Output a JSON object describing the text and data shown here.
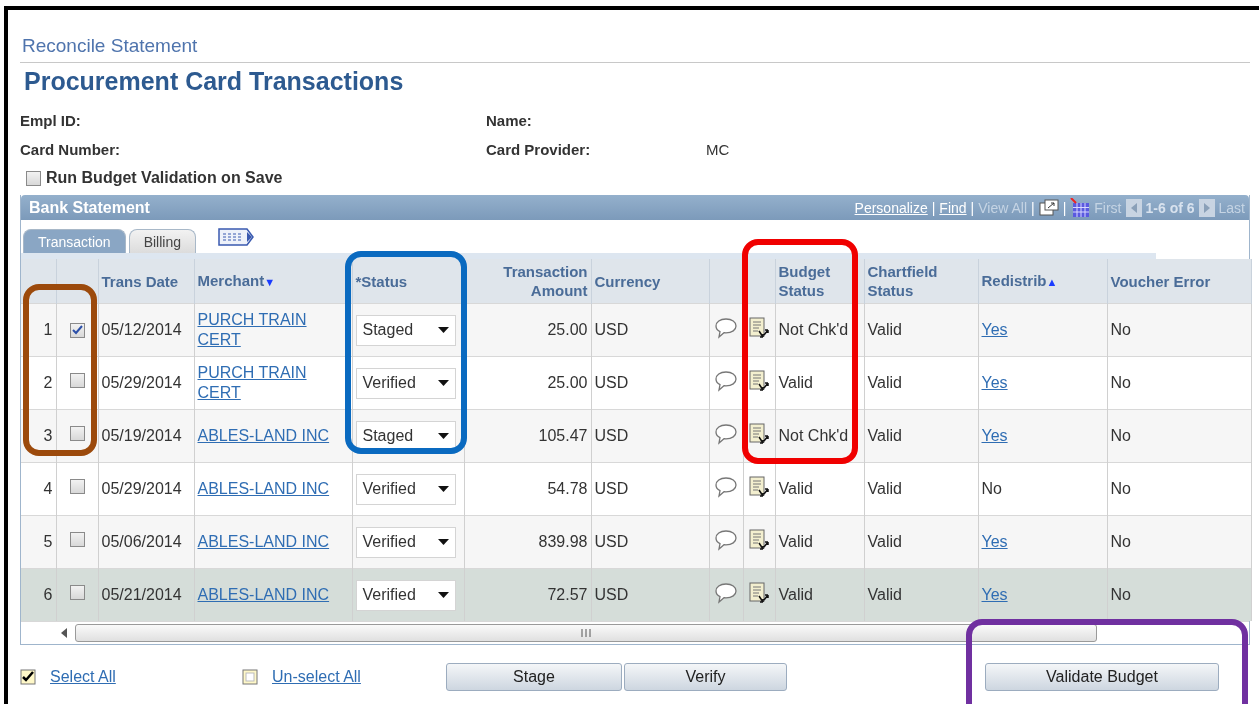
{
  "breadcrumb": "Reconcile Statement",
  "title": "Procurement Card Transactions",
  "fields": [
    {
      "label": "Empl ID:"
    },
    {
      "label": "Name:"
    },
    {
      "label": "Card Number:"
    },
    {
      "label": "Card Provider:",
      "value": "MC"
    }
  ],
  "run_budget_validation": {
    "label": "Run Budget Validation on Save",
    "checked": false
  },
  "grid": {
    "title": "Bank Statement",
    "nav": [
      {
        "kind": "link",
        "text": "Personalize"
      },
      {
        "kind": "separator",
        "text": "|"
      },
      {
        "kind": "link",
        "text": "Find"
      },
      {
        "kind": "separator",
        "text": "|"
      },
      {
        "kind": "disabled",
        "text": "View All"
      },
      {
        "kind": "separator",
        "text": "|"
      },
      {
        "kind": "zoom"
      },
      {
        "kind": "separator",
        "text": "|"
      },
      {
        "kind": "download"
      },
      {
        "kind": "disabled",
        "text": "First"
      },
      {
        "kind": "prev"
      },
      {
        "kind": "count",
        "text": "1-6 of 6"
      },
      {
        "kind": "next"
      },
      {
        "kind": "disabled",
        "text": "Last"
      }
    ],
    "tabs": [
      {
        "label": "Transaction",
        "selected": true
      },
      {
        "label": "Billing",
        "selected": false
      }
    ],
    "columns": [
      {},
      {},
      {
        "label": "Trans Date"
      },
      {
        "label": "Merchant",
        "sort_arrow": "▼"
      },
      {
        "label": "*Status"
      },
      {
        "label": "Transaction Amount"
      },
      {
        "label": "Currency"
      },
      {},
      {},
      {
        "label": "Budget Status"
      },
      {
        "label": "Chartfield Status"
      },
      {
        "label": "Redistrib",
        "sort_arrow": "▲"
      },
      {
        "label": "Voucher Error"
      }
    ],
    "rows": [
      {
        "num": "1",
        "checked": true,
        "date": "05/12/2014",
        "merchant": "PURCH TRAIN CERT",
        "status": "Staged",
        "amount": "25.00",
        "currency": "USD",
        "budget_status": "Not Chk'd",
        "chartfield_status": "Valid",
        "redistrib": {
          "text": "Yes",
          "link": true
        },
        "voucher_error": "No",
        "highlighted": false
      },
      {
        "num": "2",
        "checked": false,
        "date": "05/29/2014",
        "merchant": "PURCH TRAIN CERT",
        "status": "Verified",
        "amount": "25.00",
        "currency": "USD",
        "budget_status": "Valid",
        "chartfield_status": "Valid",
        "redistrib": {
          "text": "Yes",
          "link": true
        },
        "voucher_error": "No",
        "highlighted": false
      },
      {
        "num": "3",
        "checked": false,
        "date": "05/19/2014",
        "merchant": "ABLES-LAND INC",
        "status": "Staged",
        "amount": "105.47",
        "currency": "USD",
        "budget_status": "Not Chk'd",
        "chartfield_status": "Valid",
        "redistrib": {
          "text": "Yes",
          "link": true
        },
        "voucher_error": "No",
        "highlighted": false
      },
      {
        "num": "4",
        "checked": false,
        "date": "05/29/2014",
        "merchant": "ABLES-LAND INC",
        "status": "Verified",
        "amount": "54.78",
        "currency": "USD",
        "budget_status": "Valid",
        "chartfield_status": "Valid",
        "redistrib": {
          "text": "No",
          "link": false
        },
        "voucher_error": "No",
        "highlighted": false
      },
      {
        "num": "5",
        "checked": false,
        "date": "05/06/2014",
        "merchant": "ABLES-LAND INC",
        "status": "Verified",
        "amount": "839.98",
        "currency": "USD",
        "budget_status": "Valid",
        "chartfield_status": "Valid",
        "redistrib": {
          "text": "Yes",
          "link": true
        },
        "voucher_error": "No",
        "highlighted": false
      },
      {
        "num": "6",
        "checked": false,
        "date": "05/21/2014",
        "merchant": "ABLES-LAND INC",
        "status": "Verified",
        "amount": "72.57",
        "currency": "USD",
        "budget_status": "Valid",
        "chartfield_status": "Valid",
        "redistrib": {
          "text": "Yes",
          "link": true
        },
        "voucher_error": "No",
        "highlighted": true
      }
    ]
  },
  "actions": [
    {
      "kind": "select_all",
      "text": "Select All"
    },
    {
      "kind": "unselect_all",
      "text": "Un-select All"
    }
  ],
  "buttons": [
    {
      "label": "Stage"
    },
    {
      "label": "Verify"
    },
    {
      "label": "Validate Budget"
    }
  ],
  "callouts": [
    {
      "color": "#9c4a0c"
    },
    {
      "color": "#0a6ac0"
    },
    {
      "color": "#f00000"
    },
    {
      "color": "#7030a0"
    }
  ]
}
